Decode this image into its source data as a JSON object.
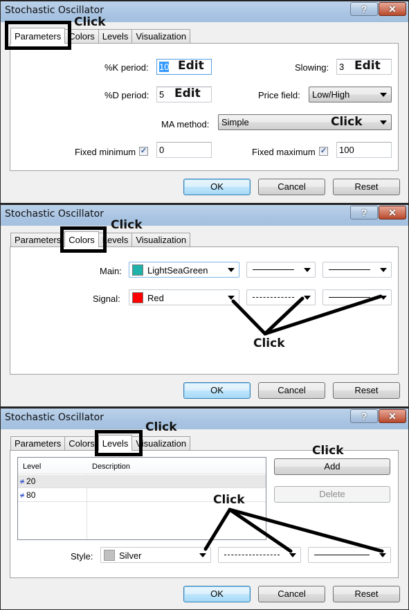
{
  "dialogs": [
    {
      "title": "Stochastic Oscillator",
      "tabs": [
        "Parameters",
        "Colors",
        "Levels",
        "Visualization"
      ],
      "active_tab": "Parameters",
      "annotation": "Click",
      "fields": {
        "k_period": {
          "label": "%K period:",
          "value": "10",
          "annotation": "Edit"
        },
        "d_period": {
          "label": "%D period:",
          "value": "5",
          "annotation": "Edit"
        },
        "slowing": {
          "label": "Slowing:",
          "value": "3",
          "annotation": "Edit"
        },
        "price_field": {
          "label": "Price field:",
          "value": "Low/High"
        },
        "ma_method": {
          "label": "MA method:",
          "value": "Simple",
          "annotation": "Click"
        },
        "fixed_minimum": {
          "label": "Fixed minimum",
          "checked": true,
          "value": "0"
        },
        "fixed_maximum": {
          "label": "Fixed maximum",
          "checked": true,
          "value": "100"
        }
      },
      "buttons": {
        "ok": "OK",
        "cancel": "Cancel",
        "reset": "Reset"
      }
    },
    {
      "title": "Stochastic Oscillator",
      "tabs": [
        "Parameters",
        "Colors",
        "Levels",
        "Visualization"
      ],
      "active_tab": "Colors",
      "annotation": "Click",
      "rows": [
        {
          "label": "Main:",
          "color_name": "LightSeaGreen",
          "color": "#20b2aa",
          "style": "solid",
          "width": "solid"
        },
        {
          "label": "Signal:",
          "color_name": "Red",
          "color": "#ff0000",
          "style": "dashed",
          "width": "solid"
        }
      ],
      "click_annotation": "Click",
      "buttons": {
        "ok": "OK",
        "cancel": "Cancel",
        "reset": "Reset"
      }
    },
    {
      "title": "Stochastic Oscillator",
      "tabs": [
        "Parameters",
        "Colors",
        "Levels",
        "Visualization"
      ],
      "active_tab": "Levels",
      "annotation": "Click",
      "table": {
        "headers": [
          "Level",
          "Description"
        ],
        "rows": [
          {
            "level": "20",
            "description": ""
          },
          {
            "level": "80",
            "description": ""
          }
        ]
      },
      "add_button": "Add",
      "add_annotation": "Click",
      "delete_button": "Delete",
      "style": {
        "label": "Style:",
        "color_name": "Silver",
        "color": "#c0c0c0",
        "line": "dashed",
        "width": "solid"
      },
      "click_annotation": "Click",
      "buttons": {
        "ok": "OK",
        "cancel": "Cancel",
        "reset": "Reset"
      }
    }
  ],
  "titlebar_buttons": {
    "help": "?",
    "close": "✕"
  }
}
